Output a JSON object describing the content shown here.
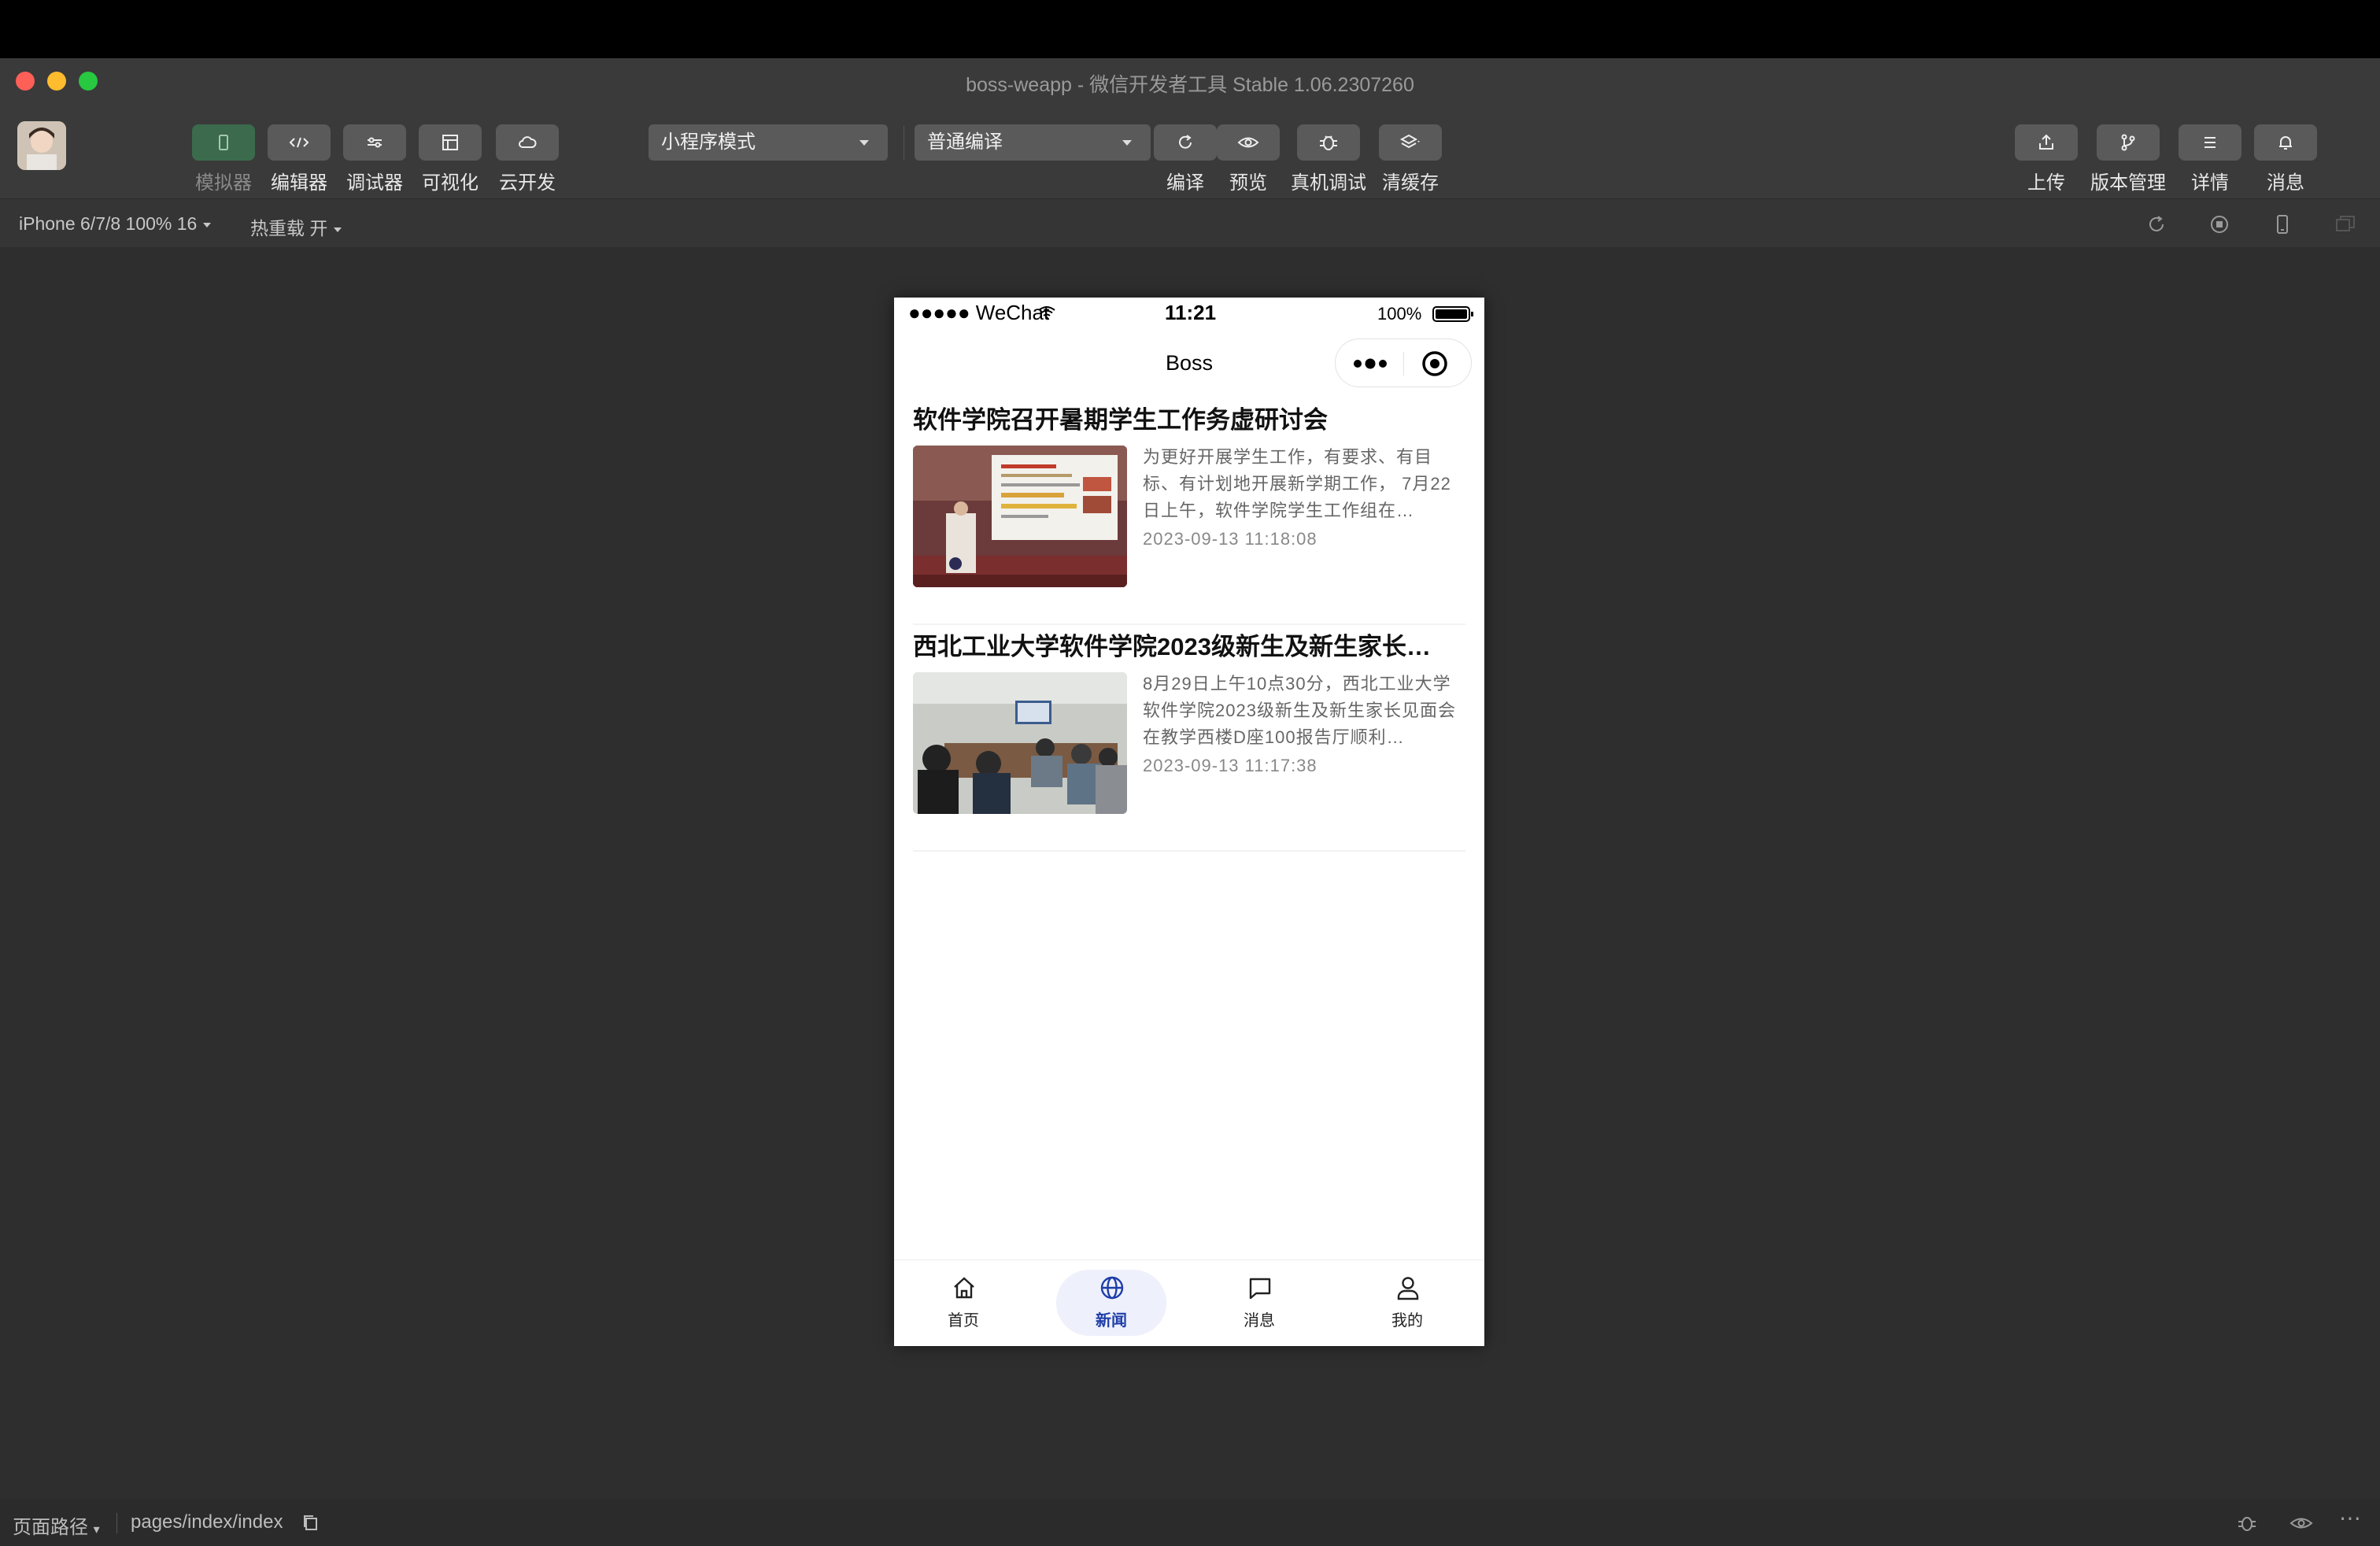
{
  "window": {
    "app_name": "boss-weapp",
    "separator": " - ",
    "app_suffix": "微信开发者工具 Stable 1.06.2307260"
  },
  "toolbar": {
    "left_buttons": [
      {
        "label": "模拟器",
        "icon": "phone-icon"
      },
      {
        "label": "编辑器",
        "icon": "code-icon"
      },
      {
        "label": "调试器",
        "icon": "debug-sliders-icon"
      },
      {
        "label": "可视化",
        "icon": "layout-icon"
      },
      {
        "label": "云开发",
        "icon": "cloud-icon"
      }
    ],
    "mode_select": "小程序模式",
    "compile_select": "普通编译",
    "mid_buttons": [
      {
        "label": "编译",
        "icon": "refresh-icon"
      },
      {
        "label": "预览",
        "icon": "eye-icon"
      },
      {
        "label": "真机调试",
        "icon": "bug-icon"
      },
      {
        "label": "清缓存",
        "icon": "layers-icon"
      }
    ],
    "right_buttons": [
      {
        "label": "上传",
        "icon": "upload-icon"
      },
      {
        "label": "版本管理",
        "icon": "branch-icon"
      },
      {
        "label": "详情",
        "icon": "menu-icon"
      },
      {
        "label": "消息",
        "icon": "bell-icon"
      }
    ]
  },
  "subbar": {
    "device": "iPhone 6/7/8 100% 16",
    "hot_reload": "热重载 开"
  },
  "phone": {
    "status": {
      "carrier": "●●●●● WeChat",
      "time": "11:21",
      "battery": "100%"
    },
    "nav_title": "Boss",
    "news": [
      {
        "title": "软件学院召开暑期学生工作务虚研讨会",
        "summary": "为更好开展学生工作，有要求、有目标、有计划地开展新学期工作， 7月22日上午，软件学院学生工作组在…",
        "date": "2023-09-13 11:18:08"
      },
      {
        "title": "西北工业大学软件学院2023级新生及新生家长…",
        "summary": "8月29日上午10点30分，西北工业大学软件学院2023级新生及新生家长见面会在教学西楼D座100报告厅顺利…",
        "date": "2023-09-13 11:17:38"
      }
    ],
    "tabs": [
      {
        "label": "首页",
        "icon": "home-icon",
        "active": false
      },
      {
        "label": "新闻",
        "icon": "globe-icon",
        "active": true
      },
      {
        "label": "消息",
        "icon": "chat-icon",
        "active": false
      },
      {
        "label": "我的",
        "icon": "user-icon",
        "active": false
      }
    ]
  },
  "footer": {
    "path_label": "页面路径",
    "path": "pages/index/index"
  },
  "colors": {
    "accent": "#1e3ea8",
    "toolbar_bg": "#3a3a3a",
    "active_green": "#3b6b4c"
  }
}
